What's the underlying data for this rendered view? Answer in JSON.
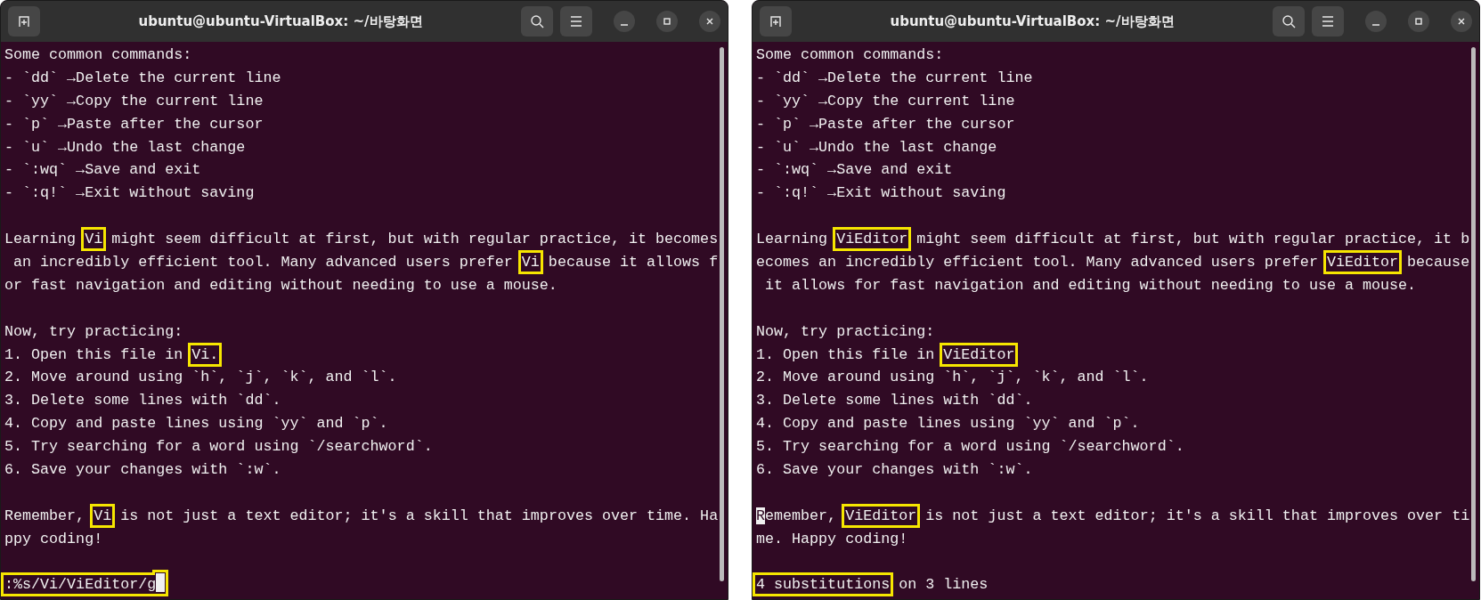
{
  "windows": [
    {
      "title": "ubuntu@ubuntu-VirtualBox: ~/바탕화면",
      "lines": [
        {
          "kind": "text",
          "segments": [
            {
              "text": "Some common commands:",
              "kind": "plain"
            }
          ]
        },
        {
          "kind": "text",
          "segments": [
            {
              "text": "- `dd` →Delete the current line",
              "kind": "plain"
            }
          ]
        },
        {
          "kind": "text",
          "segments": [
            {
              "text": "- `yy` →Copy the current line",
              "kind": "plain"
            }
          ]
        },
        {
          "kind": "text",
          "segments": [
            {
              "text": "- `p` →Paste after the cursor",
              "kind": "plain"
            }
          ]
        },
        {
          "kind": "text",
          "segments": [
            {
              "text": "- `u` →Undo the last change",
              "kind": "plain"
            }
          ]
        },
        {
          "kind": "text",
          "segments": [
            {
              "text": "- `:wq` →Save and exit",
              "kind": "plain"
            }
          ]
        },
        {
          "kind": "text",
          "segments": [
            {
              "text": "- `:q!` →Exit without saving",
              "kind": "plain"
            }
          ]
        },
        {
          "kind": "blank"
        },
        {
          "kind": "text",
          "segments": [
            {
              "text": "Learning ",
              "kind": "plain"
            },
            {
              "text": "Vi",
              "kind": "boxed"
            },
            {
              "text": " might seem difficult at first, but with regular practice, it becomes",
              "kind": "plain"
            }
          ]
        },
        {
          "kind": "text",
          "segments": [
            {
              "text": " an incredibly efficient tool. Many advanced users prefer ",
              "kind": "plain"
            },
            {
              "text": "Vi",
              "kind": "boxed"
            },
            {
              "text": " because it allows f",
              "kind": "plain"
            }
          ]
        },
        {
          "kind": "text",
          "segments": [
            {
              "text": "or fast navigation and editing without needing to use a mouse.",
              "kind": "plain"
            }
          ]
        },
        {
          "kind": "blank"
        },
        {
          "kind": "text",
          "segments": [
            {
              "text": "Now, try practicing:",
              "kind": "plain"
            }
          ]
        },
        {
          "kind": "text",
          "segments": [
            {
              "text": "1. Open this file in ",
              "kind": "plain"
            },
            {
              "text": "Vi.",
              "kind": "boxed"
            }
          ]
        },
        {
          "kind": "text",
          "segments": [
            {
              "text": "2. Move around using `h`, `j`, `k`, and `l`.",
              "kind": "plain"
            }
          ]
        },
        {
          "kind": "text",
          "segments": [
            {
              "text": "3. Delete some lines with `dd`.",
              "kind": "plain"
            }
          ]
        },
        {
          "kind": "text",
          "segments": [
            {
              "text": "4. Copy and paste lines using `yy` and `p`.",
              "kind": "plain"
            }
          ]
        },
        {
          "kind": "text",
          "segments": [
            {
              "text": "5. Try searching for a word using `/searchword`.",
              "kind": "plain"
            }
          ]
        },
        {
          "kind": "text",
          "segments": [
            {
              "text": "6. Save your changes with `:w`.",
              "kind": "plain"
            }
          ]
        },
        {
          "kind": "blank"
        },
        {
          "kind": "text",
          "segments": [
            {
              "text": "Remember, ",
              "kind": "plain"
            },
            {
              "text": "Vi",
              "kind": "boxed"
            },
            {
              "text": " is not just a text editor; it's a skill that improves over time. Ha",
              "kind": "plain"
            }
          ]
        },
        {
          "kind": "text",
          "segments": [
            {
              "text": "ppy coding!",
              "kind": "plain"
            }
          ]
        },
        {
          "kind": "blank"
        },
        {
          "kind": "text",
          "segments": [
            {
              "text": ":%s/Vi/ViEditor/g",
              "kind": "boxed",
              "cursor_after": true
            }
          ]
        }
      ]
    },
    {
      "title": "ubuntu@ubuntu-VirtualBox: ~/바탕화면",
      "lines": [
        {
          "kind": "text",
          "segments": [
            {
              "text": "Some common commands:",
              "kind": "plain"
            }
          ]
        },
        {
          "kind": "text",
          "segments": [
            {
              "text": "- `dd` →Delete the current line",
              "kind": "plain"
            }
          ]
        },
        {
          "kind": "text",
          "segments": [
            {
              "text": "- `yy` →Copy the current line",
              "kind": "plain"
            }
          ]
        },
        {
          "kind": "text",
          "segments": [
            {
              "text": "- `p` →Paste after the cursor",
              "kind": "plain"
            }
          ]
        },
        {
          "kind": "text",
          "segments": [
            {
              "text": "- `u` →Undo the last change",
              "kind": "plain"
            }
          ]
        },
        {
          "kind": "text",
          "segments": [
            {
              "text": "- `:wq` →Save and exit",
              "kind": "plain"
            }
          ]
        },
        {
          "kind": "text",
          "segments": [
            {
              "text": "- `:q!` →Exit without saving",
              "kind": "plain"
            }
          ]
        },
        {
          "kind": "blank"
        },
        {
          "kind": "text",
          "segments": [
            {
              "text": "Learning ",
              "kind": "plain"
            },
            {
              "text": "ViEditor",
              "kind": "boxed"
            },
            {
              "text": " might seem difficult at first, but with regular practice, it b",
              "kind": "plain"
            }
          ]
        },
        {
          "kind": "text",
          "segments": [
            {
              "text": "ecomes an incredibly efficient tool. Many advanced users prefer ",
              "kind": "plain"
            },
            {
              "text": "ViEditor",
              "kind": "boxed"
            },
            {
              "text": " because",
              "kind": "plain"
            }
          ]
        },
        {
          "kind": "text",
          "segments": [
            {
              "text": " it allows for fast navigation and editing without needing to use a mouse.",
              "kind": "plain"
            }
          ]
        },
        {
          "kind": "blank"
        },
        {
          "kind": "text",
          "segments": [
            {
              "text": "Now, try practicing:",
              "kind": "plain"
            }
          ]
        },
        {
          "kind": "text",
          "segments": [
            {
              "text": "1. Open this file in ",
              "kind": "plain"
            },
            {
              "text": "ViEditor",
              "kind": "boxed"
            }
          ]
        },
        {
          "kind": "text",
          "segments": [
            {
              "text": "2. Move around using `h`, `j`, `k`, and `l`.",
              "kind": "plain"
            }
          ]
        },
        {
          "kind": "text",
          "segments": [
            {
              "text": "3. Delete some lines with `dd`.",
              "kind": "plain"
            }
          ]
        },
        {
          "kind": "text",
          "segments": [
            {
              "text": "4. Copy and paste lines using `yy` and `p`.",
              "kind": "plain"
            }
          ]
        },
        {
          "kind": "text",
          "segments": [
            {
              "text": "5. Try searching for a word using `/searchword`.",
              "kind": "plain"
            }
          ]
        },
        {
          "kind": "text",
          "segments": [
            {
              "text": "6. Save your changes with `:w`.",
              "kind": "plain"
            }
          ]
        },
        {
          "kind": "blank"
        },
        {
          "kind": "text",
          "segments": [
            {
              "text": "R",
              "kind": "cursor"
            },
            {
              "text": "emember, ",
              "kind": "plain"
            },
            {
              "text": "ViEditor",
              "kind": "boxed"
            },
            {
              "text": " is not just a text editor; it's a skill that improves over ti",
              "kind": "plain"
            }
          ]
        },
        {
          "kind": "text",
          "segments": [
            {
              "text": "me. Happy coding!",
              "kind": "plain"
            }
          ]
        },
        {
          "kind": "blank"
        },
        {
          "kind": "text",
          "segments": [
            {
              "text": "4 substitutions",
              "kind": "boxed"
            },
            {
              "text": " on 3 lines",
              "kind": "plain"
            }
          ]
        }
      ]
    }
  ]
}
